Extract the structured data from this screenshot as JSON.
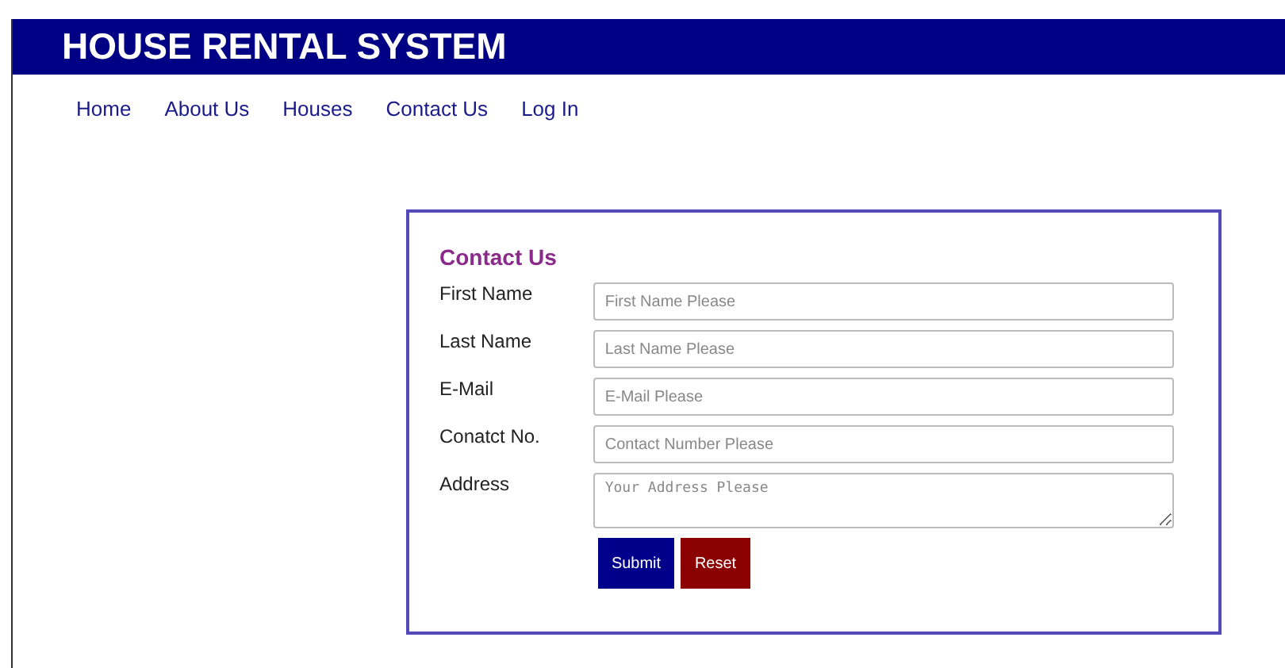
{
  "header": {
    "title": "HOUSE RENTAL SYSTEM"
  },
  "nav": [
    {
      "label": "Home"
    },
    {
      "label": "About Us"
    },
    {
      "label": "Houses"
    },
    {
      "label": "Contact Us"
    },
    {
      "label": "Log In"
    }
  ],
  "form": {
    "title": "Contact Us",
    "fields": [
      {
        "label": "First Name",
        "kind": "input",
        "placeholder": "First Name Please"
      },
      {
        "label": "Last Name",
        "kind": "input",
        "placeholder": "Last Name Please"
      },
      {
        "label": "E-Mail",
        "kind": "input",
        "placeholder": "E-Mail Please"
      },
      {
        "label": "Conatct No.",
        "kind": "input",
        "placeholder": "Contact Number Please"
      },
      {
        "label": "Address",
        "kind": "textarea",
        "placeholder": "Your Address Please"
      }
    ],
    "buttons": [
      {
        "label": "Submit",
        "kind": "submit"
      },
      {
        "label": "Reset",
        "kind": "reset"
      }
    ]
  }
}
